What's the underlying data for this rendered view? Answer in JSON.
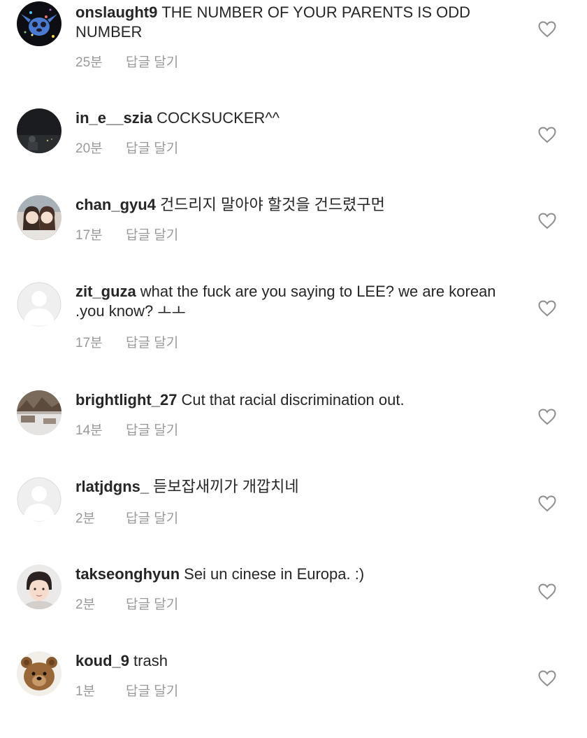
{
  "comments": [
    {
      "username": "onslaught9",
      "text": "THE NUMBER OF YOUR PARENTS IS ODD NUMBER",
      "time": "25분",
      "reply": "답글 달기",
      "avatar": "cartoon-character-avatar"
    },
    {
      "username": "in_e__szia",
      "text": "COCKSUCKER^^",
      "time": "20분",
      "reply": "답글 달기",
      "avatar": "night-photo-avatar"
    },
    {
      "username": "chan_gyu4",
      "text": "건드리지 말아야 할것을 건드렸구먼",
      "time": "17분",
      "reply": "답글 달기",
      "avatar": "two-people-photo-avatar"
    },
    {
      "username": "zit_guza",
      "text": "what the fuck are you saying to LEE? we are korean .you know? ㅗㅗ",
      "time": "17분",
      "reply": "답글 달기",
      "avatar": "default-avatar"
    },
    {
      "username": "brightlight_27",
      "text": "Cut that racial discrimination out.",
      "time": "14분",
      "reply": "답글 달기",
      "avatar": "outdoor-photo-avatar"
    },
    {
      "username": "rlatjdgns_",
      "text": "듣보잡새끼가 개깝치네",
      "time": "2분",
      "reply": "답글 달기",
      "avatar": "default-avatar"
    },
    {
      "username": "takseonghyun",
      "text": "Sei un cinese in Europa. :)",
      "time": "2분",
      "reply": "답글 달기",
      "avatar": "person-photo-avatar"
    },
    {
      "username": "koud_9",
      "text": "trash",
      "time": "1분",
      "reply": "답글 달기",
      "avatar": "teddy-bear-avatar"
    }
  ]
}
